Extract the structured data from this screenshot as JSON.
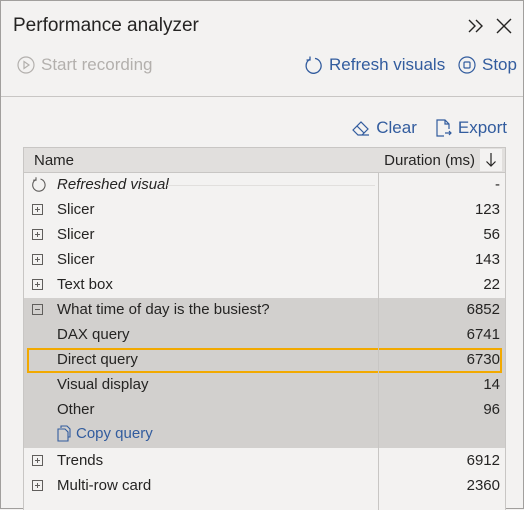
{
  "panel": {
    "title": "Performance analyzer",
    "icons": {
      "collapse": "double-chevron-right-icon",
      "close": "close-icon"
    }
  },
  "toolbar": {
    "start_recording": "Start recording",
    "refresh_visuals": "Refresh visuals",
    "stop": "Stop"
  },
  "actions": {
    "clear": "Clear",
    "export": "Export"
  },
  "table": {
    "columns": {
      "name": "Name",
      "duration": "Duration (ms)"
    },
    "sort_direction": "descending",
    "rows": [
      {
        "label": "Refreshed visual",
        "value": "-",
        "type": "refreshed"
      },
      {
        "label": "Slicer",
        "value": "123",
        "type": "collapsed"
      },
      {
        "label": "Slicer",
        "value": "56",
        "type": "collapsed"
      },
      {
        "label": "Slicer",
        "value": "143",
        "type": "collapsed"
      },
      {
        "label": "Text box",
        "value": "22",
        "type": "collapsed"
      },
      {
        "label": "What time of day is the busiest?",
        "value": "6852",
        "type": "expanded"
      },
      {
        "label": "DAX query",
        "value": "6741",
        "type": "child"
      },
      {
        "label": "Direct query",
        "value": "6730",
        "type": "child",
        "highlighted": true
      },
      {
        "label": "Visual display",
        "value": "14",
        "type": "child"
      },
      {
        "label": "Other",
        "value": "96",
        "type": "child"
      },
      {
        "label": "Copy query",
        "value": "",
        "type": "link"
      },
      {
        "label": "Trends",
        "value": "6912",
        "type": "collapsed"
      },
      {
        "label": "Multi-row card",
        "value": "2360",
        "type": "collapsed"
      }
    ]
  },
  "colors": {
    "accent": "#325c9e",
    "highlight": "#f2a900",
    "selected_group": "#d2d0ce"
  }
}
